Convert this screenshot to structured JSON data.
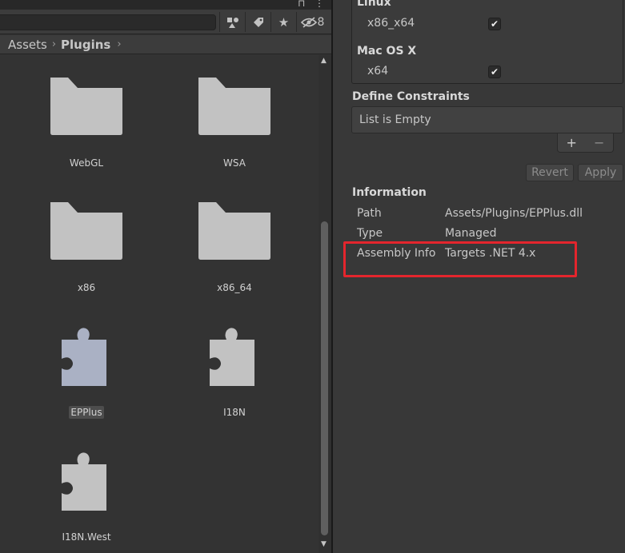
{
  "window": {
    "lock_icon": "lock-icon",
    "menu_icon": "kebab-menu-icon"
  },
  "toolbar": {
    "hidden_count": "8",
    "icons": [
      "search-by-type-icon",
      "label-tag-icon",
      "favorite-star-icon",
      "hidden-eye-icon"
    ]
  },
  "breadcrumb": {
    "items": [
      "Assets",
      "Plugins"
    ],
    "separator": ">"
  },
  "assets": [
    {
      "name": "WebGL",
      "kind": "folder"
    },
    {
      "name": "WSA",
      "kind": "folder"
    },
    {
      "name": "x86",
      "kind": "folder"
    },
    {
      "name": "x86_64",
      "kind": "folder"
    },
    {
      "name": "EPPlus",
      "kind": "plugin",
      "selected": true
    },
    {
      "name": "I18N",
      "kind": "plugin"
    },
    {
      "name": "I18N.West",
      "kind": "plugin"
    }
  ],
  "platforms": [
    {
      "os": "Linux",
      "arch": "x86_x64",
      "checked": true
    },
    {
      "os": "Mac OS X",
      "arch": "x64",
      "checked": true
    }
  ],
  "define_constraints": {
    "header": "Define Constraints",
    "empty": "List is Empty",
    "add": "+",
    "remove": "−"
  },
  "actions": {
    "revert": "Revert",
    "apply": "Apply"
  },
  "information": {
    "header": "Information",
    "rows": [
      {
        "key": "Path",
        "value": "Assets/Plugins/EPPlus.dll"
      },
      {
        "key": "Type",
        "value": "Managed"
      },
      {
        "key": "Assembly Info",
        "value": "Targets .NET 4.x"
      }
    ]
  },
  "colors": {
    "highlight": "#e4252d",
    "folder": "#c2c2c2",
    "plugin_selected": "#aab1c4"
  }
}
